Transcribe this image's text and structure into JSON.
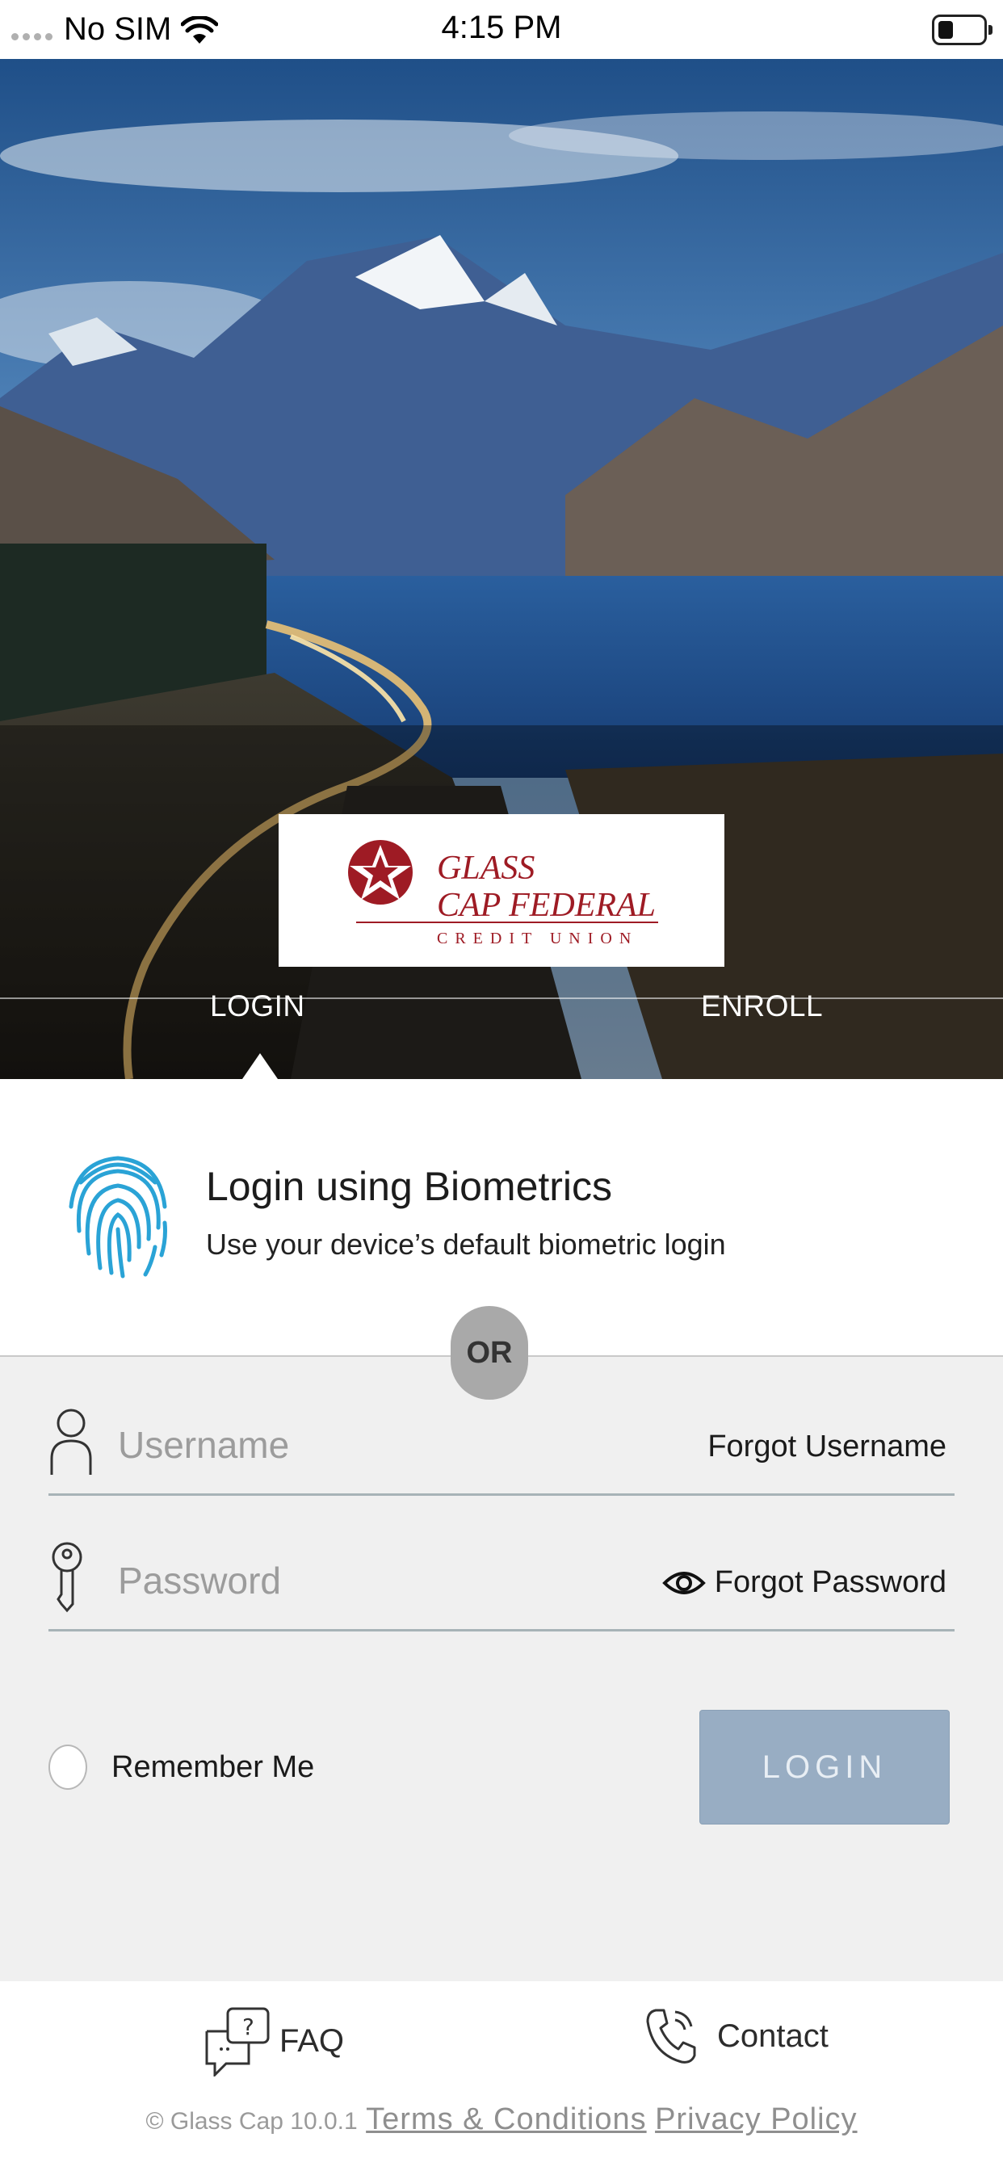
{
  "status_bar": {
    "carrier": "No SIM",
    "time": "4:15 PM",
    "icons": [
      "signal-dots-icon",
      "wifi-icon",
      "battery-icon"
    ]
  },
  "hero": {
    "logo_line1": "GLASS",
    "logo_line2": "CAP FEDERAL",
    "logo_line3": "CREDIT UNION",
    "tabs": [
      {
        "label": "LOGIN",
        "active": true
      },
      {
        "label": "ENROLL",
        "active": false
      }
    ]
  },
  "biometrics": {
    "icon": "fingerprint-icon",
    "title": "Login using Biometrics",
    "subtitle": "Use your device’s default biometric login"
  },
  "divider": {
    "label": "OR"
  },
  "form": {
    "username": {
      "placeholder": "Username",
      "value": "",
      "forgot_label": "Forgot Username",
      "icon": "user-icon"
    },
    "password": {
      "placeholder": "Password",
      "value": "",
      "forgot_label": "Forgot Password",
      "icon": "key-icon",
      "toggle_icon": "eye-icon"
    },
    "remember_label": "Remember Me",
    "remember_checked": false,
    "login_label": "LOGIN"
  },
  "footer": {
    "faq_label": "FAQ",
    "contact_label": "Contact",
    "version": "© Glass Cap 10.0.1",
    "terms_label": "Terms & Conditions",
    "privacy_label": "Privacy Policy"
  },
  "colors": {
    "login_button": "#98adc3",
    "fingerprint": "#2aa3d6",
    "brand_red": "#9e1b24",
    "form_background": "#f0f0f0"
  }
}
